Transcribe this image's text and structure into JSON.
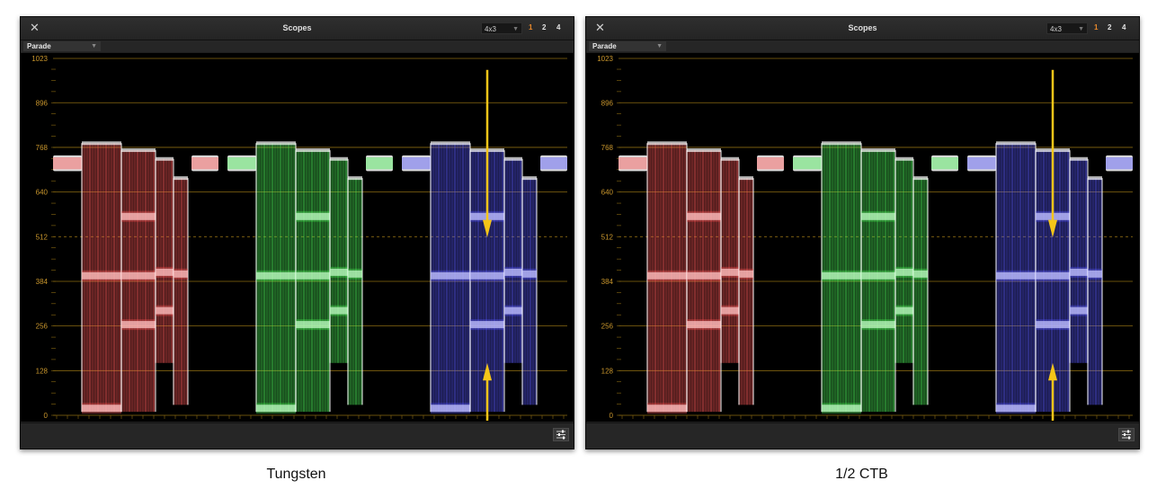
{
  "panels": [
    {
      "title": "Scopes",
      "layout": "4x3",
      "counts": [
        "1",
        "2",
        "4"
      ],
      "mode": "Parade",
      "scale_labels": [
        "1023",
        "896",
        "768",
        "640",
        "512",
        "384",
        "256",
        "128",
        "0"
      ],
      "caption": "Tungsten"
    },
    {
      "title": "Scopes",
      "layout": "4x3",
      "counts": [
        "1",
        "2",
        "4"
      ],
      "mode": "Parade",
      "scale_labels": [
        "1023",
        "896",
        "768",
        "640",
        "512",
        "384",
        "256",
        "128",
        "0"
      ],
      "caption": "1/2 CTB"
    }
  ],
  "colors": {
    "grid": "#8a6a12",
    "label": "#c9962c",
    "arrow": "#f5c518",
    "red": "#ff5a5a",
    "green": "#4df25a",
    "blue": "#5a5aff",
    "active_count": "#e8892c"
  },
  "icons": [
    "close-icon",
    "chevron-down-icon",
    "settings-sliders-icon"
  ]
}
